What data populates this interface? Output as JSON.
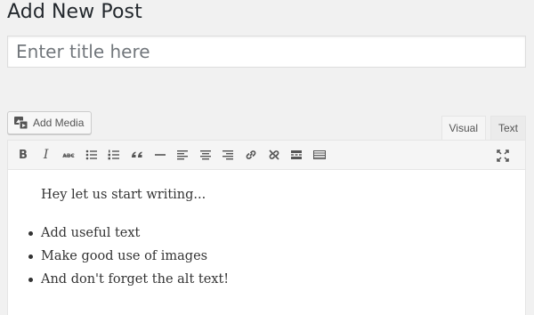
{
  "page": {
    "title": "Add New Post"
  },
  "title_field": {
    "placeholder": "Enter title here",
    "value": ""
  },
  "media": {
    "add_media_label": "Add Media"
  },
  "tabs": [
    {
      "label": "Visual",
      "active": true
    },
    {
      "label": "Text",
      "active": false
    }
  ],
  "toolbar": {
    "bold_label": "B",
    "italic_label": "I",
    "buttons": [
      "bold-icon",
      "italic-icon",
      "strikethrough-icon",
      "bulleted-list-icon",
      "numbered-list-icon",
      "blockquote-icon",
      "horizontal-line-icon",
      "align-left-icon",
      "align-center-icon",
      "align-right-icon",
      "insert-link-icon",
      "remove-link-icon",
      "read-more-icon",
      "toolbar-toggle-icon",
      "fullscreen-icon"
    ]
  },
  "content": {
    "intro": "Hey let us start writing...",
    "list": [
      "Add useful text",
      "Make good use of images",
      "And don't forget the alt text!"
    ]
  },
  "colors": {
    "background": "#f1f1f1",
    "border": "#e5e5e5",
    "text": "#23282d",
    "icon": "#555555"
  }
}
